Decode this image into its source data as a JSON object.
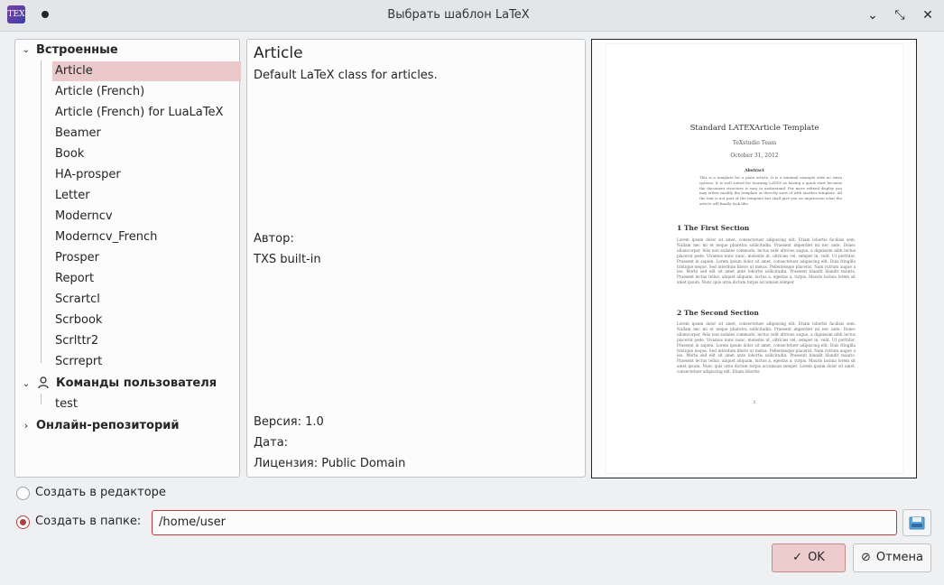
{
  "window": {
    "title": "Выбрать шаблон LaTeX",
    "app_icon_text": "TEX",
    "controls": {
      "minimize": "⌄",
      "maximize": "⤡",
      "close": "✕"
    }
  },
  "tree": {
    "groups": [
      {
        "label": "Встроенные",
        "expanded": true,
        "icon": "none",
        "items": [
          "Article",
          "Article (French)",
          "Article (French) for LuaLaTeX",
          "Beamer",
          "Book",
          "HA-prosper",
          "Letter",
          "Moderncv",
          "Moderncv_French",
          "Prosper",
          "Report",
          "Scrartcl",
          "Scrbook",
          "Scrlttr2",
          "Scrreprt"
        ],
        "selected": "Article"
      },
      {
        "label": "Команды пользователя",
        "expanded": true,
        "icon": "user-icon",
        "items": [
          "test"
        ]
      },
      {
        "label": "Онлайн-репозиторий",
        "expanded": false,
        "icon": "none",
        "items": []
      }
    ]
  },
  "info": {
    "name": "Article",
    "description": "Default LaTeX class for articles.",
    "author_label": "Автор:",
    "author": "TXS built-in",
    "version": "Версия: 1.0",
    "date": "Дата:",
    "license": "Лицензия: Public Domain"
  },
  "preview": {
    "title": "Standard LATEXArticle Template",
    "author": "TeXstudio Team",
    "date": "October 31, 2012",
    "abstract_heading": "Abstract",
    "abstract": "This is a template for a plain article. It is a minimal example with no extra options. It is well suited for learning LATEX as having a quick start because the document structure is easy to understand. For more refined display you may either modify the template or directly start of with another template. All the text is not part of the template but shall give you an impression what the article will finally look like.",
    "section1": "1   The First Section",
    "section1_text": "Lorem ipsum dolor sit amet, consectetuer adipiscing elit. Etiam lobortis facilisis sem. Nullam nec mi et neque pharetra sollicitudin. Praesent imperdiet mi nec ante. Donec ullamcorper, felis non sodales commodo, lectus velit ultrices augue, a dignissim nibh lectus placerat pede. Vivamus nunc nunc, molestie ut, ultricies vel, semper in, velit. Ut porttitor. Praesent in sapien. Lorem ipsum dolor sit amet, consectetuer adipiscing elit. Duis fringilla tristique neque. Sed interdum libero ut metus. Pellentesque placerat. Nam rutrum augue a leo. Morbi sed elit sit amet ante lobortis sollicitudin. Praesent blandit blandit mauris. Praesent lectus tellus, aliquet aliquam, luctus a, egestas a, turpis. Mauris lacinia lorem sit amet ipsum. Nunc quis urna dictum turpis accumsan semper.",
    "section2": "2   The Second Section",
    "section2_text": "Lorem ipsum dolor sit amet, consectetuer adipiscing elit. Etiam lobortis facilisis sem. Nullam nec mi et neque pharetra sollicitudin. Praesent imperdiet mi nec ante. Donec ullamcorper, felis non sodales commodo, lectus velit ultrices augue, a dignissim nibh lectus placerat pede. Vivamus nunc nunc, molestie ut, ultricies vel, semper in, velit. Ut porttitor. Praesent in sapien. Lorem ipsum dolor sit amet, consectetuer adipiscing elit. Duis fringilla tristique neque. Sed interdum libero ut metus. Pellentesque placerat. Nam rutrum augue a leo. Morbi sed elit sit amet ante lobortis sollicitudin. Praesent blandit blandit mauris. Praesent lectus tellus, aliquet aliquam, luctus a, egestas a, turpis. Mauris lacinia lorem sit amet ipsum. Nunc quis urna dictum turpis accumsan semper. Lorem ipsum dolor sit amet, consectetuer adipiscing elit. Etiam lobortis",
    "page_number": "1"
  },
  "options": {
    "create_in_editor": "Создать в редакторе",
    "create_in_folder": "Создать в папке:",
    "selected": "create_in_folder",
    "folder_path": "/home/user"
  },
  "buttons": {
    "ok": "OK",
    "cancel": "Отмена"
  },
  "colors": {
    "accent": "#b04044",
    "selection": "#ebc8c9"
  }
}
